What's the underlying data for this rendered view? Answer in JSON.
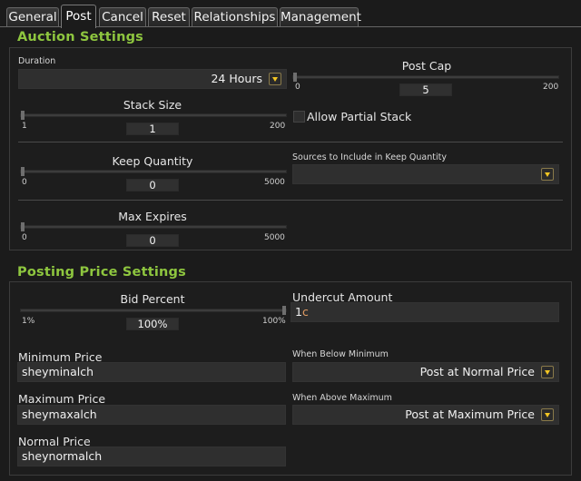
{
  "tabs": [
    {
      "label": "General",
      "active": false
    },
    {
      "label": "Post",
      "active": true
    },
    {
      "label": "Cancel",
      "active": false
    },
    {
      "label": "Reset",
      "active": false
    },
    {
      "label": "Relationships",
      "active": false
    },
    {
      "label": "Management",
      "active": false
    }
  ],
  "auction": {
    "title": "Auction Settings",
    "duration": {
      "label": "Duration",
      "value": "24 Hours"
    },
    "post_cap": {
      "label": "Post Cap",
      "value": "5",
      "min": "0",
      "max": "200"
    },
    "stack_size": {
      "label": "Stack Size",
      "value": "1",
      "min": "1",
      "max": "200"
    },
    "allow_partial_stack": {
      "label": "Allow Partial Stack",
      "checked": false
    },
    "keep_quantity": {
      "label": "Keep Quantity",
      "value": "0",
      "min": "0",
      "max": "5000"
    },
    "sources_keep_quantity": {
      "label": "Sources to Include in Keep Quantity",
      "value": ""
    },
    "max_expires": {
      "label": "Max Expires",
      "value": "0",
      "min": "0",
      "max": "5000"
    }
  },
  "posting": {
    "title": "Posting Price Settings",
    "bid_percent": {
      "label": "Bid Percent",
      "value": "100%",
      "min": "1%",
      "max": "100%"
    },
    "undercut_amount": {
      "label": "Undercut Amount",
      "number": "1",
      "unit": "c"
    },
    "minimum_price": {
      "label": "Minimum Price",
      "value": "sheyminalch"
    },
    "when_below_minimum": {
      "label": "When Below Minimum",
      "value": "Post at Normal Price"
    },
    "maximum_price": {
      "label": "Maximum Price",
      "value": "sheymaxalch"
    },
    "when_above_maximum": {
      "label": "When Above Maximum",
      "value": "Post at Maximum Price"
    },
    "normal_price": {
      "label": "Normal Price",
      "value": "sheynormalch"
    }
  },
  "colors": {
    "section_title": "#8ec63f",
    "dropdown_arrow": "#f2c522",
    "copper": "#e29c62"
  },
  "icons": {
    "dropdown": "chevron-down-icon"
  }
}
